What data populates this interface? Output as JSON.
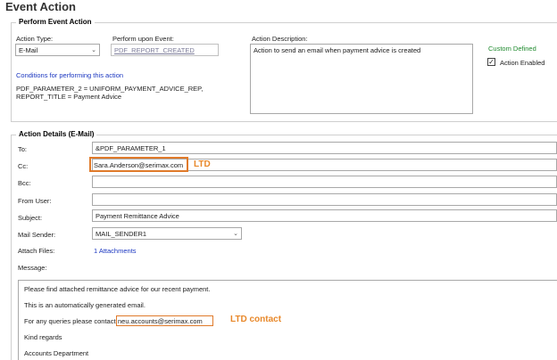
{
  "page_title": "Event Action",
  "perform_group": {
    "title": "Perform Event Action",
    "action_type_label": "Action Type:",
    "action_type_value": "E-Mail",
    "perform_event_label": "Perform upon Event:",
    "perform_event_value": "PDF_REPORT_CREATED",
    "description_label": "Action Description:",
    "description_value": "Action to send an email when payment advice is created",
    "custom_defined": "Custom Defined",
    "action_enabled_label": "Action Enabled",
    "action_enabled_checked": true,
    "conditions_link": "Conditions for performing this action",
    "condition_line_1": "PDF_PARAMETER_2 = UNIFORM_PAYMENT_ADVICE_REP,",
    "condition_line_2": "REPORT_TITLE = Payment Advice"
  },
  "details_group": {
    "title": "Action Details (E-Mail)",
    "to_label": "To:",
    "to_value": "&PDF_PARAMETER_1",
    "cc_label": "Cc:",
    "cc_value": "Sara.Anderson@serimax.com",
    "cc_annotation": "LTD",
    "bcc_label": "Bcc:",
    "bcc_value": "",
    "from_label": "From User:",
    "from_value": "",
    "subject_label": "Subject:",
    "subject_value": "Payment Remittance Advice",
    "sender_label": "Mail Sender:",
    "sender_value": "MAIL_SENDER1",
    "attach_label": "Attach Files:",
    "attach_value": "1 Attachments",
    "message_label": "Message:"
  },
  "message": {
    "line_1": "Please find attached remittance advice for our recent payment.",
    "line_2": "This is an automatically generated email.",
    "line_3": "For any queries please contact",
    "contact_email": "neu.accounts@serimax.com",
    "contact_annotation": "LTD contact",
    "line_4": "Kind regards",
    "line_5": "Accounts Department"
  },
  "colors": {
    "link": "#1a36c0",
    "custom_defined": "#1f8a2e",
    "annotation": "#e07a2a"
  }
}
